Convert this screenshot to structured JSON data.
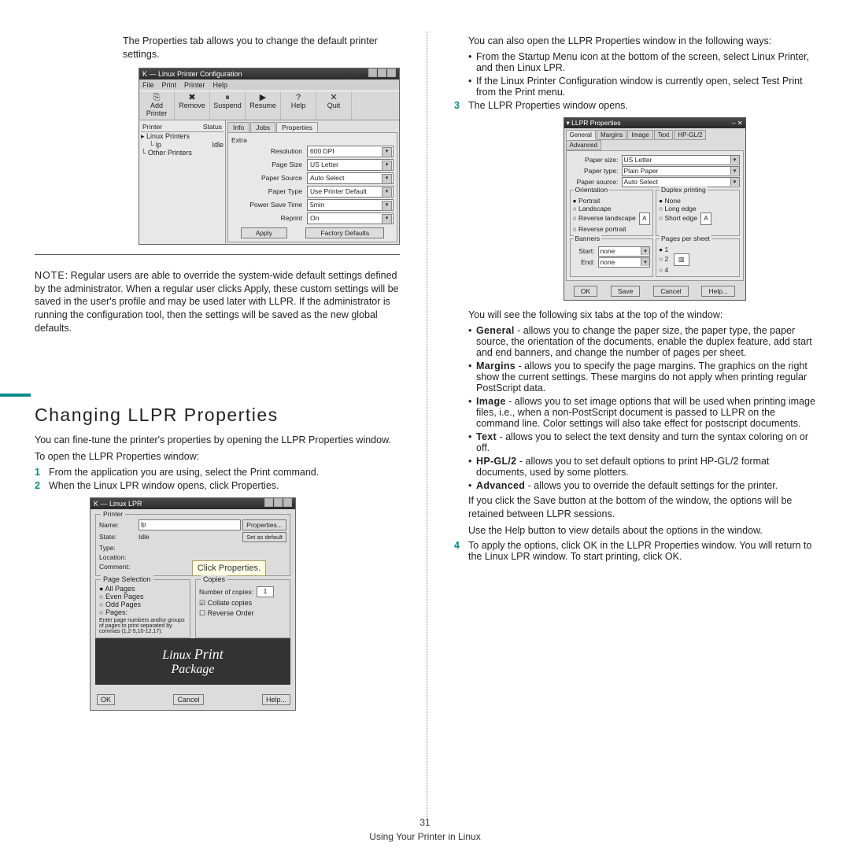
{
  "left": {
    "intro": "The Properties tab allows you to change the default printer settings.",
    "note_label": "NOTE",
    "note": ": Regular users are able to override the system-wide default settings defined by the administrator. When a regular user clicks Apply, these custom settings will be saved in the user's profile and may be used later with LLPR. If the administrator is running the configuration tool, then the settings will be saved as the new global defaults.",
    "section_title": "Changing LLPR Properties",
    "p1": "You can fine-tune the printer's properties by opening the LLPR Properties window.",
    "p2": "To open the LLPR Properties window:",
    "step1": "From the application you are using, select the Print command.",
    "step2": "When the Linux LPR window opens, click Properties.",
    "callout": "Click Properties."
  },
  "right": {
    "intro": "You can also open the LLPR Properties window in the following ways:",
    "b1": "From the Startup Menu icon at the bottom of the screen, select Linux Printer, and then Linux LPR.",
    "b2": "If the Linux Printer Configuration window is currently open, select Test Print from the Print menu.",
    "step3": "The LLPR Properties window opens.",
    "after": "You will see the following six tabs at the top of the window:",
    "tab_general": "General - allows you to change the paper size, the paper type, the paper source, the orientation of the documents, enable the duplex feature, add start and end banners, and change the number of pages per sheet.",
    "tab_margins": "Margins - allows you to specify the page margins. The graphics on the right show the current settings. These margins do not apply when printing regular PostScript data.",
    "tab_image": "Image - allows you to set image options that will be used when printing image files, i.e., when a non-PostScript document is passed to LLPR on the command line. Color settings will also take effect for postscript documents.",
    "tab_text": "Text - allows you to select the text density and turn the syntax coloring on or off.",
    "tab_hpgl": "HP-GL/2 - allows you to set default options to print HP-GL/2 format documents, used by some plotters.",
    "tab_adv": "Advanced - allows you to override the default settings for the printer.",
    "save": "If you click the Save button at the bottom of the window, the options will be retained between LLPR sessions.",
    "help": "Use the Help button to view details about the options in the window.",
    "step4": "To apply the options, click OK in the LLPR Properties window. You will return to the Linux LPR window. To start printing, click OK."
  },
  "configshot": {
    "title": "Linux Printer Configuration",
    "menus": [
      "File",
      "Print",
      "Printer",
      "Help"
    ],
    "toolbar": [
      "Add Printer",
      "Remove",
      "Suspend",
      "Resume",
      "Help",
      "Quit"
    ],
    "tree_hdr1": "Printer",
    "tree_hdr2": "Status",
    "tree1": "Linux Printers",
    "tree1a": "lp",
    "tree1a_s": "Idle",
    "tree2": "Other Printers",
    "tabs": [
      "Info",
      "Jobs",
      "Properties"
    ],
    "group": "Extra",
    "rows": [
      [
        "Resolution",
        "600 DPI"
      ],
      [
        "Page Size",
        "US Letter"
      ],
      [
        "Paper Source",
        "Auto Select"
      ],
      [
        "Paper Type",
        "Use Printer Default"
      ],
      [
        "Power Save Time",
        "5min"
      ],
      [
        "Reprint",
        "On"
      ]
    ],
    "apply": "Apply",
    "defaults": "Factory Defaults"
  },
  "lprshot": {
    "title": "Linux LPR",
    "grp_printer": "Printer",
    "name": "Name:",
    "name_v": "lp",
    "props": "Properties...",
    "state": "State:",
    "state_v": "Idle",
    "def": "Set as default",
    "type": "Type:",
    "loc": "Location:",
    "com": "Comment:",
    "grp_ps": "Page Selection",
    "grp_cp": "Copies",
    "all": "All Pages",
    "even": "Even Pages",
    "odd": "Odd Pages",
    "pages": "Pages:",
    "hint": "Enter page numbers and/or groups of pages to print separated by commas (1,2-5,10-12,17).",
    "copies": "Number of copies:",
    "copies_v": "1",
    "collate": "Collate copies",
    "reverse": "Reverse Order",
    "banner1": "Linux",
    "banner2": "Print",
    "banner3": "Package",
    "ok": "OK",
    "cancel": "Cancel",
    "help": "Help..."
  },
  "llpr": {
    "title": "LLPR Properties",
    "tabs": [
      "General",
      "Margins",
      "Image",
      "Text",
      "HP-GL/2",
      "Advanced"
    ],
    "psize": "Paper size:",
    "psize_v": "US Letter",
    "ptype": "Paper type:",
    "ptype_v": "Plain Paper",
    "psrc": "Paper source:",
    "psrc_v": "Auto Select",
    "orient": "Orientation",
    "portrait": "Portrait",
    "land": "Landscape",
    "revland": "Reverse landscape",
    "revport": "Reverse portrait",
    "duplex": "Duplex printing",
    "none": "None",
    "long": "Long edge",
    "short": "Short edge",
    "banners": "Banners",
    "pps": "Pages per sheet",
    "start": "Start:",
    "end": "End:",
    "noneval": "none",
    "p1": "1",
    "p2": "2",
    "p4": "4",
    "ok": "OK",
    "save": "Save",
    "cancel": "Cancel",
    "help": "Help..."
  },
  "footer": {
    "page": "31",
    "text": "Using Your Printer in Linux"
  }
}
